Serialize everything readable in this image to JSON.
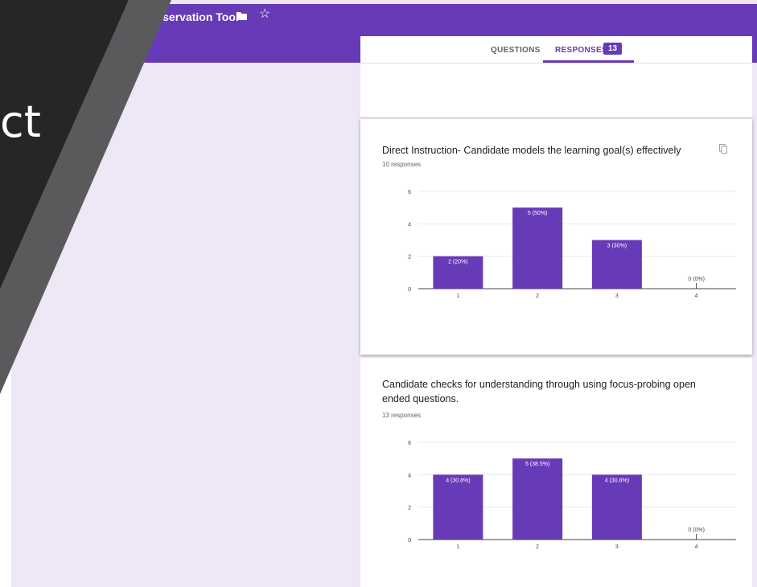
{
  "header": {
    "title": "racy Observation Tool",
    "overlay_text": "ct"
  },
  "tabs": {
    "questions": "QUESTIONS",
    "responses": "RESPONSES",
    "responses_count": "13"
  },
  "colors": {
    "brand": "#673ab7",
    "background": "#ede7f6",
    "bar": "#673ab7"
  },
  "icons": [
    "folder-icon",
    "star-icon",
    "copy-icon"
  ],
  "cards": [
    {
      "question": "Direct Instruction- Candidate models the learning goal(s) effectively",
      "responses_label": "10 responses"
    },
    {
      "question": "Candidate checks for understanding through using focus-probing open ended questions.",
      "responses_label": "13 responses"
    }
  ],
  "chart_data": [
    {
      "type": "bar",
      "categories": [
        "1",
        "2",
        "3",
        "4"
      ],
      "values": [
        2,
        5,
        3,
        0
      ],
      "labels": [
        "2 (20%)",
        "5 (50%)",
        "3 (30%)",
        "0 (0%)"
      ],
      "ylim": [
        0,
        6
      ],
      "yticks": [
        "0",
        "2",
        "4",
        "6"
      ],
      "grid": true
    },
    {
      "type": "bar",
      "categories": [
        "1",
        "2",
        "3",
        "4"
      ],
      "values": [
        4,
        5,
        4,
        0
      ],
      "labels": [
        "4 (30.8%)",
        "5 (38.5%)",
        "4 (30.8%)",
        "0 (0%)"
      ],
      "ylim": [
        0,
        6
      ],
      "yticks": [
        "0",
        "2",
        "4",
        "6"
      ],
      "grid": true
    }
  ]
}
